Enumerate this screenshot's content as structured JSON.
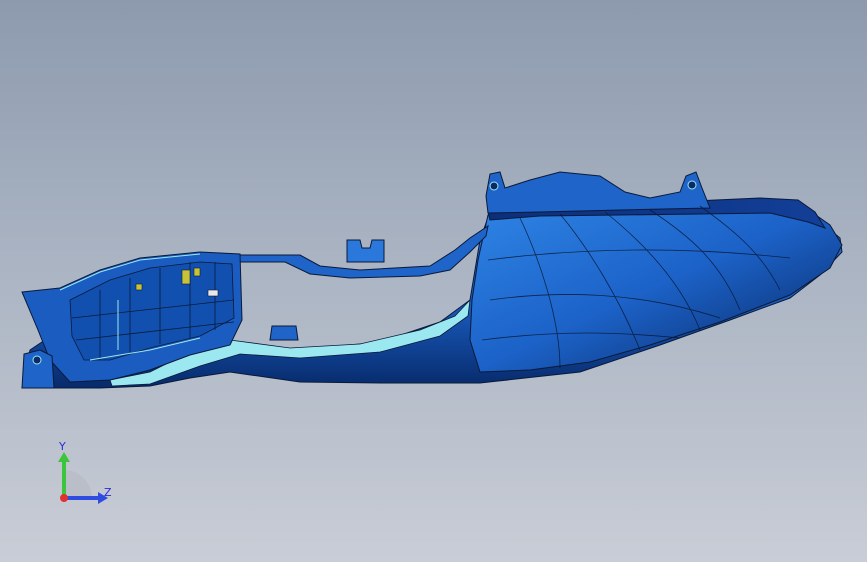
{
  "viewport": {
    "background_top": "#8d9aae",
    "background_bottom": "#c9cdd6"
  },
  "model": {
    "body_color": "#1f64c8",
    "dark_color": "#0b2a66",
    "edge_color": "#0a1a3a",
    "highlight_color": "#9be8f0",
    "accent_color": "#c8c23a"
  },
  "triad": {
    "y_label": "Y",
    "z_label": "Z",
    "y_color": "#3cc43c",
    "z_color": "#2e4de0",
    "x_color": "#e03030"
  }
}
